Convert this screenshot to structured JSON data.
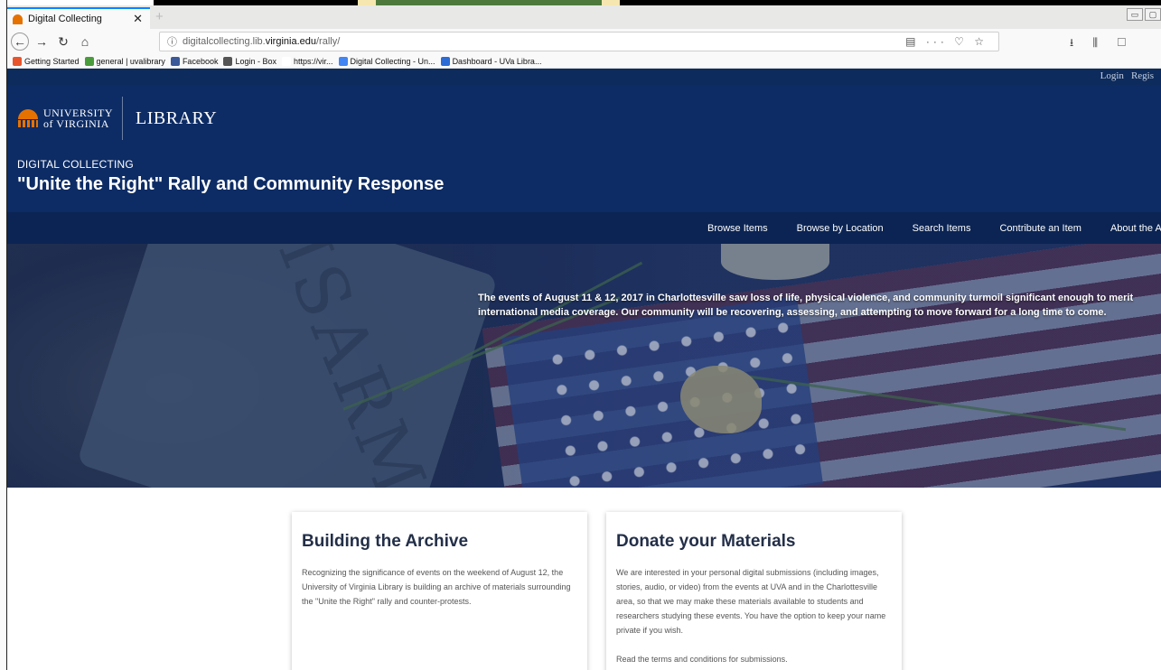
{
  "browser": {
    "tab_title": "Digital Collecting",
    "tab_close": "✕",
    "new_tab": "+",
    "url_prefix": "digitalcollecting.lib.",
    "url_host": "virginia.edu",
    "url_path": "/rally/",
    "url_actions": "▤ ··· ♡ ☆",
    "toolbar_icons": "⭳ ⫼ ▢ ◉",
    "bookmarks": [
      {
        "label": "Getting Started",
        "color": "#e8552c"
      },
      {
        "label": "general | uvalibrary",
        "color": "#4a9b3c"
      },
      {
        "label": "Facebook",
        "color": "#3b5998"
      },
      {
        "label": "Login - Box",
        "color": "#555555"
      },
      {
        "label": "https://vir...",
        "color": "#ffffff"
      },
      {
        "label": "Digital Collecting - Un...",
        "color": "#4285f4"
      },
      {
        "label": "Dashboard - UVa Libra...",
        "color": "#2a6bd6"
      }
    ]
  },
  "utility": {
    "login": "Login",
    "register": "Regis"
  },
  "header": {
    "logo_line1": "UNIVERSITY",
    "logo_line2": "of VIRGINIA",
    "library": "LIBRARY",
    "kicker": "DIGITAL COLLECTING",
    "title": "\"Unite the Right\" Rally and Community Response"
  },
  "nav": {
    "items": [
      "Browse Items",
      "Browse by Location",
      "Search Items",
      "Contribute an Item",
      "About the Archi"
    ]
  },
  "hero": {
    "sign_text": "DISARM",
    "text": "The events of August 11 & 12, 2017 in Charlottesville saw loss of life, physical violence, and community turmoil significant enough to merit international media coverage. Our community will be recovering, assessing, and attempting to move forward for a long time to come."
  },
  "cards": {
    "archive": {
      "title": "Building the Archive",
      "body": "Recognizing the significance of events on the weekend of August 12, the University of Virginia Library is building an archive of materials surrounding the \"Unite the Right\" rally and counter-protests."
    },
    "donate": {
      "title": "Donate your Materials",
      "body": "We are interested in your personal digital submissions (including images, stories, audio, or video) from the events at UVA and in the Charlottesville area, so that we may make these materials available to students and researchers studying these events. You have the option to keep your name private if you wish.",
      "terms": "Read the terms and conditions for submissions."
    }
  },
  "colors": {
    "header_blue": "#0d2c65",
    "nav_blue": "#0b2453",
    "uva_orange": "#e57200"
  }
}
